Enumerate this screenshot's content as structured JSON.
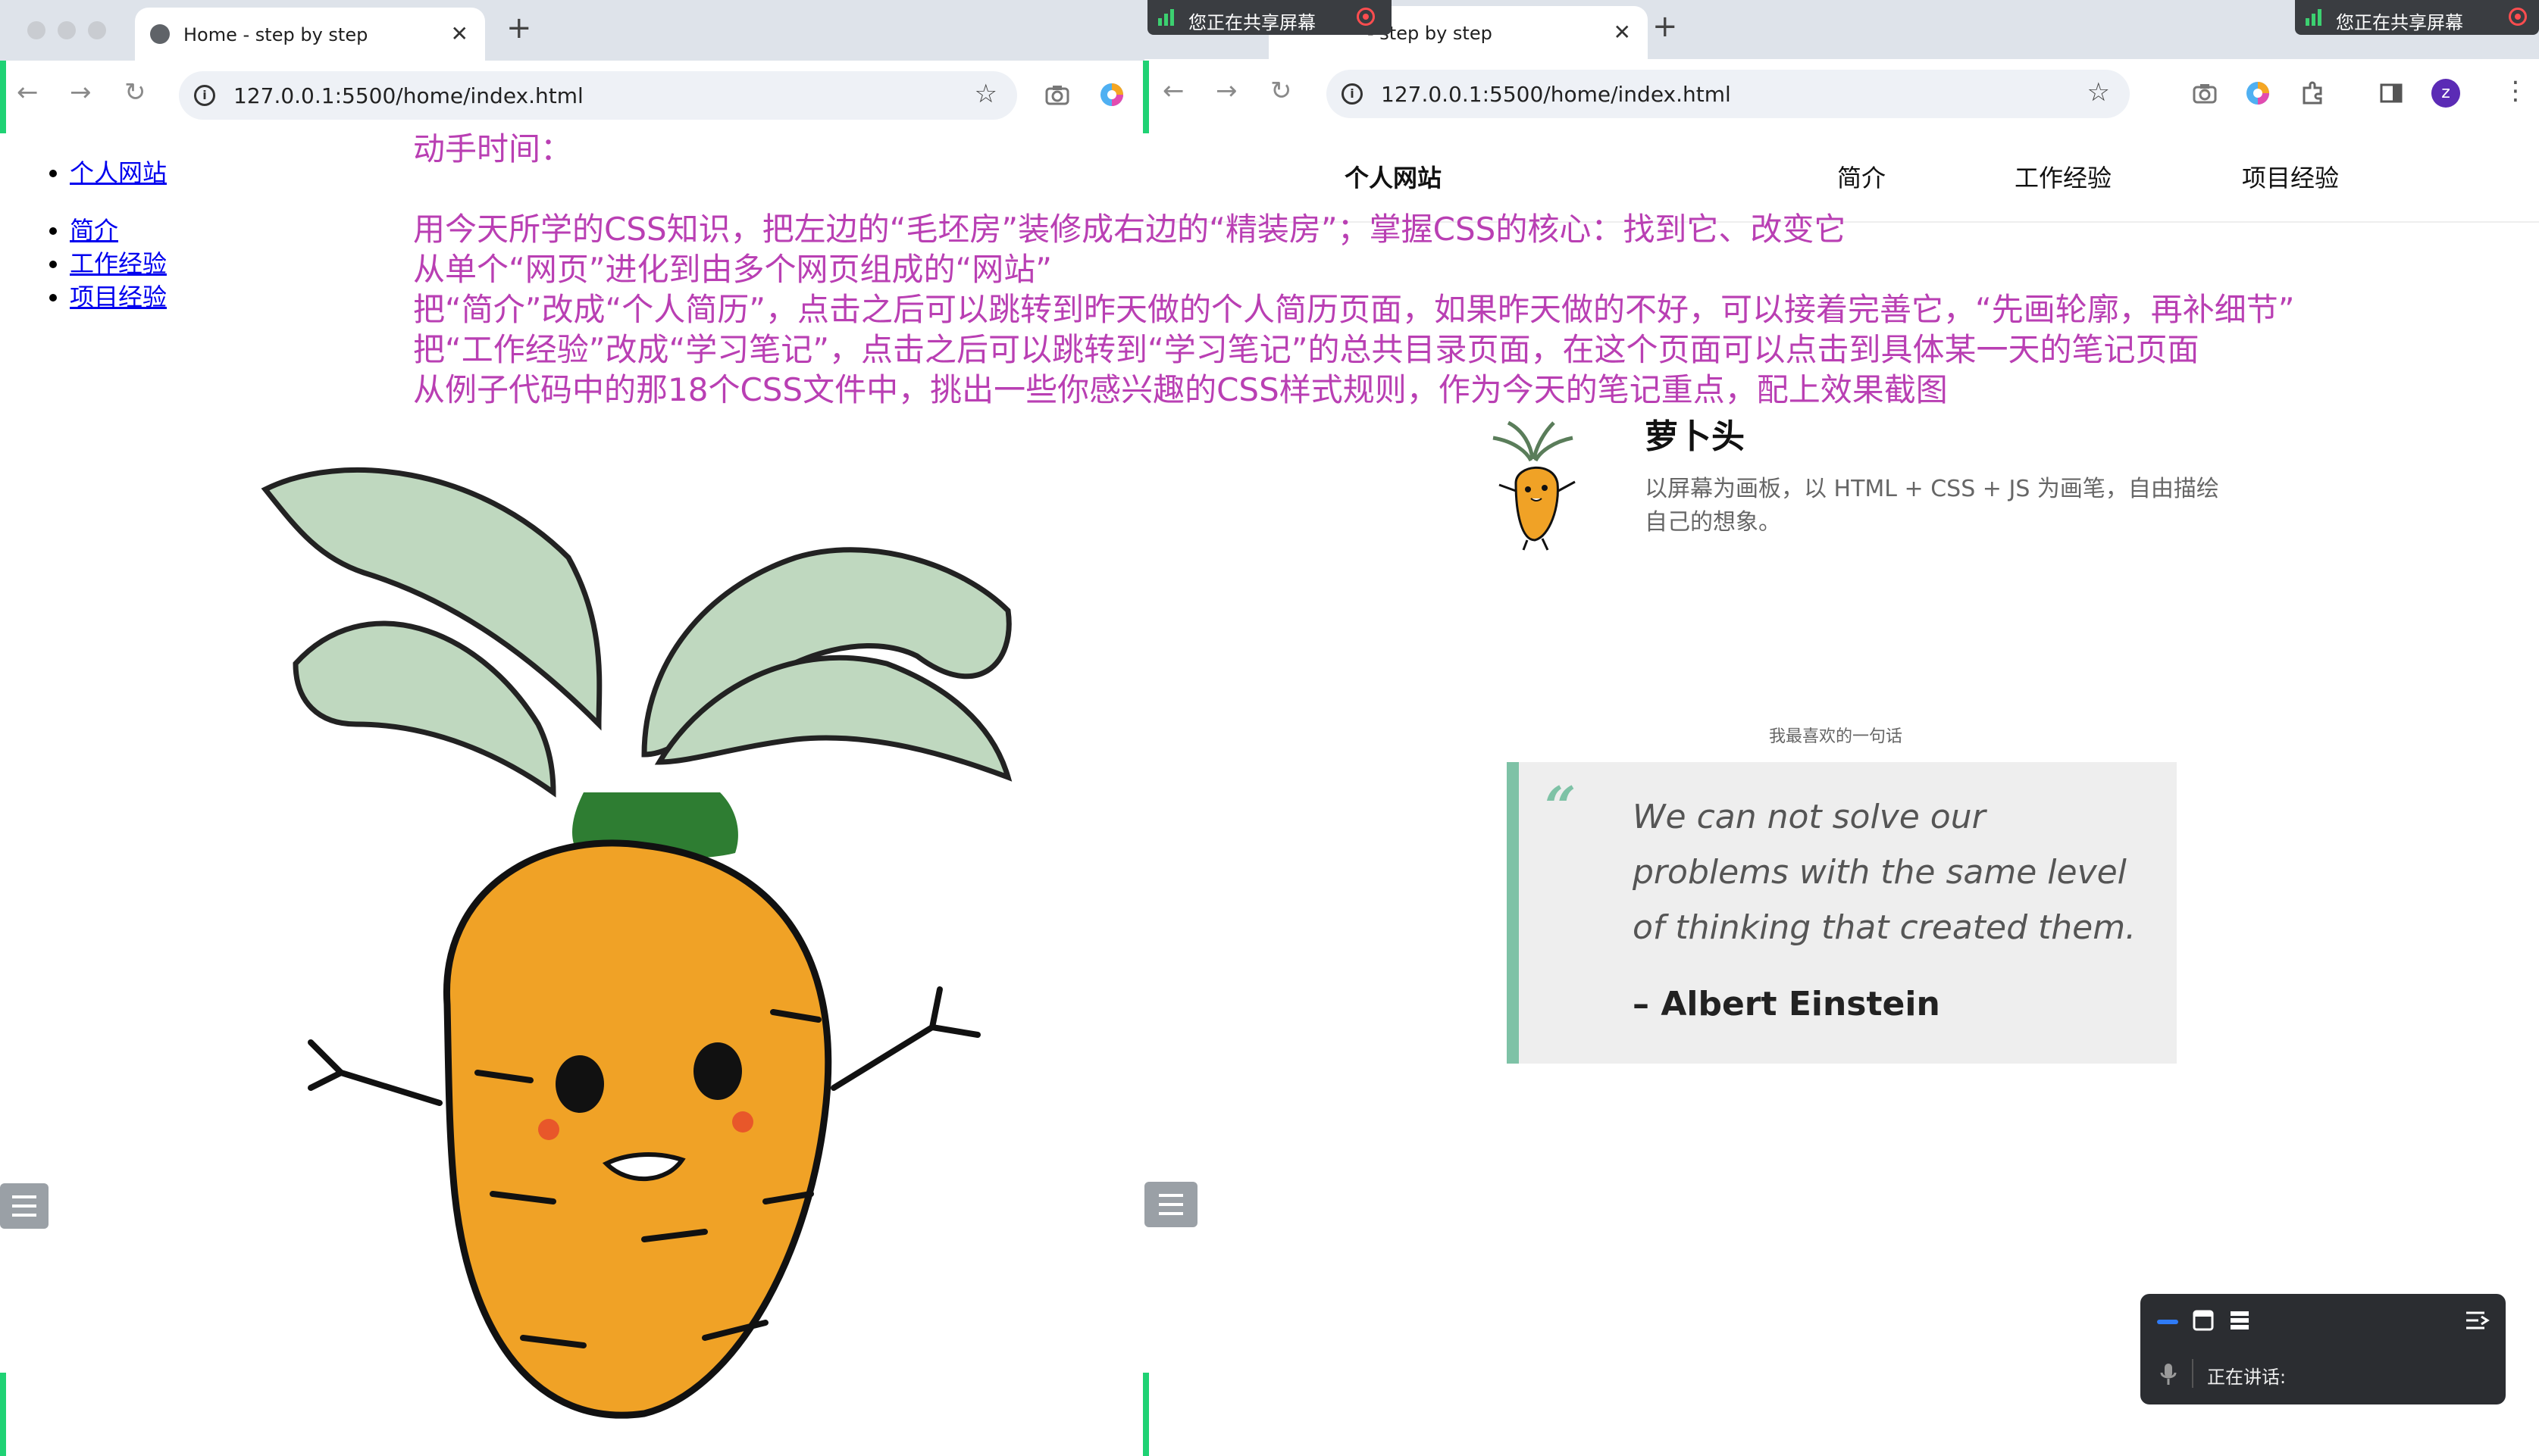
{
  "left_window": {
    "tab_title": "Home - step by step",
    "url": "127.0.0.1:5500/home/index.html",
    "nav_top": [
      "个人网站"
    ],
    "nav_links": [
      "简介",
      "工作经验",
      "项目经验"
    ]
  },
  "right_window": {
    "tab_title": "- step by step",
    "url": "127.0.0.1:5500/home/index.html",
    "nav": {
      "brand": "个人网站",
      "items": [
        "简介",
        "工作经验",
        "项目经验"
      ]
    },
    "profile": {
      "name": "萝卜头",
      "desc": "以屏幕为画板，以 HTML + CSS + JS 为画笔，自由描绘自己的想象。"
    },
    "favorite_label": "我最喜欢的一句话",
    "quote": {
      "mark": "“",
      "text": "We can not solve our problems with the same level of thinking that created them.",
      "author": "– Albert Einstein"
    }
  },
  "overlay": {
    "lines": [
      "动手时间：",
      "",
      "用今天所学的CSS知识，把左边的“毛坯房”装修成右边的“精装房”；掌握CSS的核心：找到它、改变它",
      "从单个“网页”进化到由多个网页组成的“网站”",
      "把“简介”改成“个人简历”，点击之后可以跳转到昨天做的个人简历页面，如果昨天做的不好，可以接着完善它，“先画轮廓，再补细节”",
      "把“工作经验”改成“学习笔记”，点击之后可以跳转到“学习笔记”的总共目录页面，在这个页面可以点击到具体某一天的笔记页面",
      "从例子代码中的那18个CSS文件中，挑出一些你感兴趣的CSS样式规则，作为今天的笔记重点，配上效果截图"
    ]
  },
  "screen_share": {
    "badge_text": "您正在共享屏幕"
  },
  "meeting_panel": {
    "speaking_label": "正在讲话:"
  },
  "colors": {
    "overlay_text": "#b93fb3",
    "quote_accent": "#7ec2a6",
    "share_green": "#1fd274",
    "tab_strip": "#dee3ea"
  },
  "icons": [
    "globe-icon",
    "back-arrow-icon",
    "forward-arrow-icon",
    "reload-icon",
    "info-icon",
    "star-icon",
    "camera-icon",
    "color-wheel-icon",
    "extensions-icon",
    "sidepanel-icon",
    "profile-avatar-icon",
    "more-icon",
    "list-menu-icon",
    "carrot-illustration",
    "microphone-icon"
  ],
  "profile_avatar_letter": "z"
}
